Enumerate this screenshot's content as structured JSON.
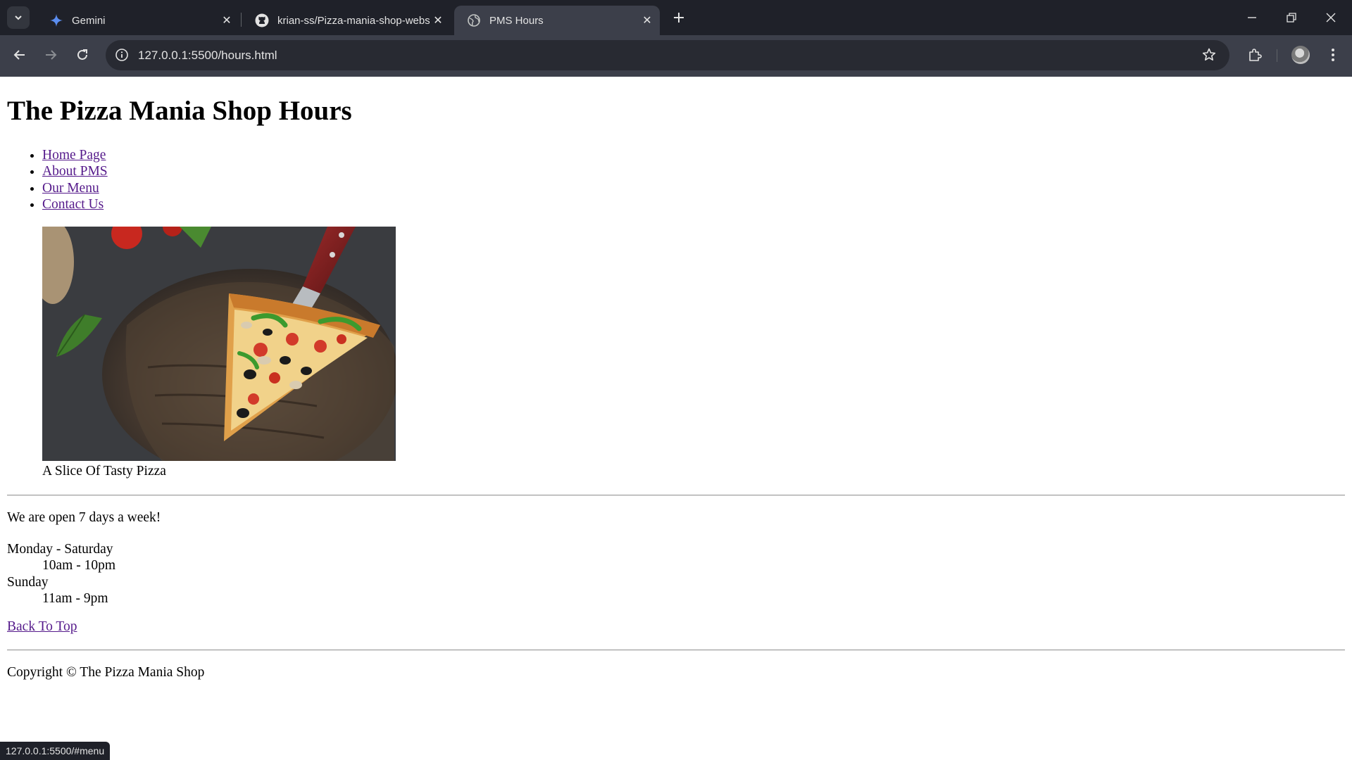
{
  "browser": {
    "tabs": [
      {
        "title": "Gemini",
        "icon": "gemini-sparkle-icon",
        "active": false
      },
      {
        "title": "krian-ss/Pizza-mania-shop-website",
        "icon": "github-icon",
        "active": false
      },
      {
        "title": "PMS Hours",
        "icon": "globe-icon",
        "active": true
      }
    ],
    "url": "127.0.0.1:5500/hours.html",
    "status_url": "127.0.0.1:5500/#menu",
    "colors": {
      "chrome": "#202124",
      "toolbar": "#3c3f4a",
      "omnibox": "#282a32",
      "text": "#e3e3e3"
    }
  },
  "page": {
    "heading": "The Pizza Mania Shop Hours",
    "nav": [
      {
        "label": "Home Page"
      },
      {
        "label": "About PMS"
      },
      {
        "label": "Our Menu"
      },
      {
        "label": "Contact Us"
      }
    ],
    "image_alt": "A slice of pizza on a wooden board",
    "caption": "A Slice Of Tasty Pizza",
    "open_text": "We are open 7 days a week!",
    "hours": [
      {
        "days": "Monday - Saturday",
        "time": "10am - 10pm"
      },
      {
        "days": "Sunday",
        "time": "11am - 9pm"
      }
    ],
    "back_to_top": "Back To Top",
    "copyright": "Copyright © The Pizza Mania Shop",
    "colors": {
      "visited_link": "#551a8b",
      "text": "#000000",
      "background": "#ffffff"
    }
  }
}
